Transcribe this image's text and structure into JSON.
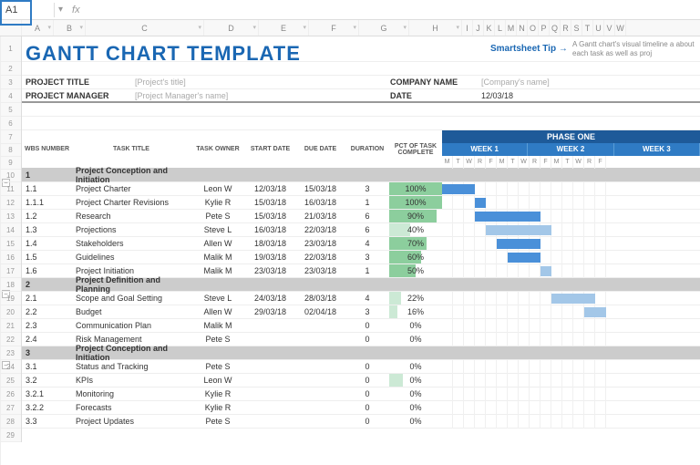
{
  "cell_ref": "A1",
  "title": "GANTT CHART TEMPLATE",
  "tip_link": "Smartsheet Tip →",
  "tip_text": "A Gantt chart's visual timeline a about each task as well as proj",
  "labels": {
    "project_title": "PROJECT TITLE",
    "project_manager": "PROJECT MANAGER",
    "company_name": "COMPANY NAME",
    "date": "DATE"
  },
  "placeholders": {
    "project_title": "[Project's title]",
    "project_manager": "[Project Manager's name]",
    "company_name": "[Company's name]"
  },
  "date_value": "12/03/18",
  "cols": [
    "A",
    "B",
    "C",
    "D",
    "E",
    "F",
    "G",
    "H",
    "I",
    "J",
    "K",
    "L",
    "M",
    "N",
    "O",
    "P",
    "Q",
    "R",
    "S",
    "T",
    "U",
    "V",
    "W"
  ],
  "headers": {
    "wbs": "WBS NUMBER",
    "task": "TASK TITLE",
    "owner": "TASK OWNER",
    "start": "START DATE",
    "due": "DUE DATE",
    "dur": "DURATION",
    "pct": "PCT OF TASK COMPLETE",
    "phase": "PHASE ONE",
    "weeks": [
      "WEEK 1",
      "WEEK 2",
      "WEEK 3"
    ],
    "days": [
      "M",
      "T",
      "W",
      "R",
      "F",
      "M",
      "T",
      "W",
      "R",
      "F",
      "M",
      "T",
      "W",
      "R",
      "F"
    ]
  },
  "sections": [
    {
      "wbs": "1",
      "title": "Project Conception and Initiation",
      "row": 11,
      "tasks": [
        {
          "wbs": "1.1",
          "title": "Project Charter",
          "owner": "Leon W",
          "start": "12/03/18",
          "due": "15/03/18",
          "dur": "3",
          "pct": "100%",
          "pctW": 100,
          "bar": [
            0,
            3
          ],
          "row": 12
        },
        {
          "wbs": "1.1.1",
          "title": "Project Charter Revisions",
          "owner": "Kylie R",
          "start": "15/03/18",
          "due": "16/03/18",
          "dur": "1",
          "pct": "100%",
          "pctW": 100,
          "bar": [
            3,
            1
          ],
          "row": 13
        },
        {
          "wbs": "1.2",
          "title": "Research",
          "owner": "Pete S",
          "start": "15/03/18",
          "due": "21/03/18",
          "dur": "6",
          "pct": "90%",
          "pctW": 90,
          "bar": [
            3,
            6
          ],
          "row": 14
        },
        {
          "wbs": "1.3",
          "title": "Projections",
          "owner": "Steve L",
          "start": "16/03/18",
          "due": "22/03/18",
          "dur": "6",
          "pct": "40%",
          "pctW": 40,
          "bar": [
            4,
            6
          ],
          "lt": true,
          "row": 15
        },
        {
          "wbs": "1.4",
          "title": "Stakeholders",
          "owner": "Allen W",
          "start": "18/03/18",
          "due": "23/03/18",
          "dur": "4",
          "pct": "70%",
          "pctW": 70,
          "bar": [
            5,
            4
          ],
          "row": 16
        },
        {
          "wbs": "1.5",
          "title": "Guidelines",
          "owner": "Malik M",
          "start": "19/03/18",
          "due": "22/03/18",
          "dur": "3",
          "pct": "60%",
          "pctW": 60,
          "bar": [
            6,
            3
          ],
          "row": 17
        },
        {
          "wbs": "1.6",
          "title": "Project Initiation",
          "owner": "Malik M",
          "start": "23/03/18",
          "due": "23/03/18",
          "dur": "1",
          "pct": "50%",
          "pctW": 50,
          "bar": [
            9,
            1
          ],
          "lt": true,
          "row": 18
        }
      ]
    },
    {
      "wbs": "2",
      "title": "Project Definition and Planning",
      "row": 19,
      "tasks": [
        {
          "wbs": "2.1",
          "title": "Scope and Goal Setting",
          "owner": "Steve L",
          "start": "24/03/18",
          "due": "28/03/18",
          "dur": "4",
          "pct": "22%",
          "pctW": 22,
          "bar": [
            10,
            4
          ],
          "lt": true,
          "row": 20
        },
        {
          "wbs": "2.2",
          "title": "Budget",
          "owner": "Allen W",
          "start": "29/03/18",
          "due": "02/04/18",
          "dur": "3",
          "pct": "16%",
          "pctW": 16,
          "bar": [
            13,
            2
          ],
          "lt": true,
          "row": 21
        },
        {
          "wbs": "2.3",
          "title": "Communication Plan",
          "owner": "Malik M",
          "start": "",
          "due": "",
          "dur": "0",
          "pct": "0%",
          "pctW": 0,
          "row": 22
        },
        {
          "wbs": "2.4",
          "title": "Risk Management",
          "owner": "Pete S",
          "start": "",
          "due": "",
          "dur": "0",
          "pct": "0%",
          "pctW": 0,
          "row": 23
        }
      ]
    },
    {
      "wbs": "3",
      "title": "Project Conception and Initiation",
      "row": 24,
      "tasks": [
        {
          "wbs": "3.1",
          "title": "Status and Tracking",
          "owner": "Pete S",
          "start": "",
          "due": "",
          "dur": "0",
          "pct": "0%",
          "pctW": 0,
          "row": 25
        },
        {
          "wbs": "3.2",
          "title": "KPIs",
          "owner": "Leon W",
          "start": "",
          "due": "",
          "dur": "0",
          "pct": "0%",
          "pctW": 26
        },
        {
          "wbs": "3.2.1",
          "title": "Monitoring",
          "owner": "Kylie R",
          "start": "",
          "due": "",
          "dur": "0",
          "pct": "0%",
          "pctW": 0,
          "row": 27
        },
        {
          "wbs": "3.2.2",
          "title": "Forecasts",
          "owner": "Kylie R",
          "start": "",
          "due": "",
          "dur": "0",
          "pct": "0%",
          "pctW": 0,
          "row": 28
        },
        {
          "wbs": "3.3",
          "title": "Project Updates",
          "owner": "Pete S",
          "start": "",
          "due": "",
          "dur": "0",
          "pct": "0%",
          "pctW": 0,
          "row": 29
        }
      ]
    }
  ]
}
